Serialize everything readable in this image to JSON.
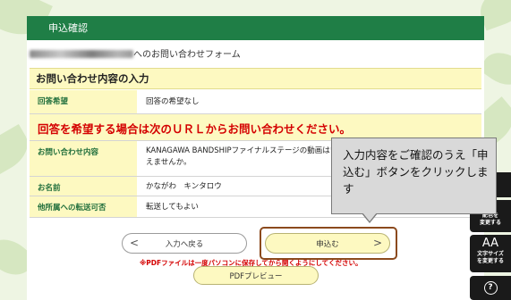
{
  "header": {
    "title": "申込確認"
  },
  "form_name_suffix": "へのお問い合わせフォーム",
  "section": {
    "title": "お問い合わせ内容の入力"
  },
  "rows": [
    {
      "label": "回答希望",
      "value": "回答の希望なし"
    },
    {
      "label": "お問い合わせ内容",
      "value": "KANAGAWA BANDSHIPファイナルステージの動画はいつ公開されますか。\nえませんか。"
    },
    {
      "label": "お名前",
      "value": "かながわ　キンタロウ"
    },
    {
      "label": "他所属への転送可否",
      "value": "転送してもよい"
    }
  ],
  "notice": "回答を希望する場合は次のＵＲＬからお問い合わせください。",
  "buttons": {
    "back_label": "入力へ戻る",
    "back_chevron": "<",
    "submit_label": "申込む",
    "submit_chevron": ">",
    "pdf_preview_label": "PDFプレビュー"
  },
  "pdf_note": "※PDFファイルは一度パソコンに保存してから開くようにしてください。",
  "callout": {
    "text": "入力内容をご確認のうえ「申込む」ボタンをクリックします"
  },
  "side_toolbar": {
    "item_a": "ら",
    "color_change": "配色を\n変更する",
    "font_size_icon_text": "AA",
    "font_size_change": "文字サイズ\nを変更する",
    "help_icon_text": "?"
  },
  "colors": {
    "header_green": "#1f7e46",
    "label_yellow": "#fdf9c1",
    "notice_red": "#d40000",
    "highlight_brown": "#8b4a1d"
  }
}
